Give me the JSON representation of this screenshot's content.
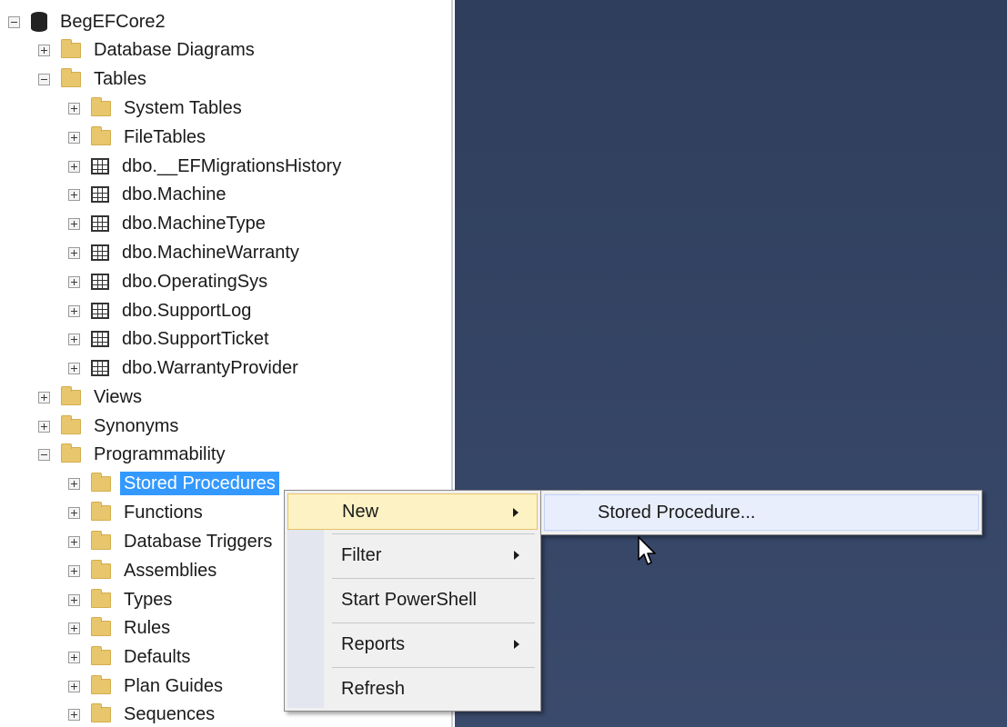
{
  "tree": {
    "database": "BegEFCore2",
    "items": [
      {
        "label": "Database Diagrams"
      },
      {
        "label": "Tables"
      },
      {
        "label": "System Tables"
      },
      {
        "label": "FileTables"
      },
      {
        "label": "dbo.__EFMigrationsHistory"
      },
      {
        "label": "dbo.Machine"
      },
      {
        "label": "dbo.MachineType"
      },
      {
        "label": "dbo.MachineWarranty"
      },
      {
        "label": "dbo.OperatingSys"
      },
      {
        "label": "dbo.SupportLog"
      },
      {
        "label": "dbo.SupportTicket"
      },
      {
        "label": "dbo.WarrantyProvider"
      },
      {
        "label": "Views"
      },
      {
        "label": "Synonyms"
      },
      {
        "label": "Programmability"
      },
      {
        "label": "Stored Procedures"
      },
      {
        "label": "Functions"
      },
      {
        "label": "Database Triggers"
      },
      {
        "label": "Assemblies"
      },
      {
        "label": "Types"
      },
      {
        "label": "Rules"
      },
      {
        "label": "Defaults"
      },
      {
        "label": "Plan Guides"
      },
      {
        "label": "Sequences"
      }
    ]
  },
  "context_menu": {
    "items": [
      {
        "label": "New"
      },
      {
        "label": "Filter"
      },
      {
        "label": "Start PowerShell"
      },
      {
        "label": "Reports"
      },
      {
        "label": "Refresh"
      }
    ]
  },
  "submenu": {
    "items": [
      {
        "label": "Stored Procedure..."
      }
    ]
  },
  "colors": {
    "selection": "#3399ff",
    "document_area": "#2f3e5c",
    "menu_highlight": "#fdf2c4"
  }
}
